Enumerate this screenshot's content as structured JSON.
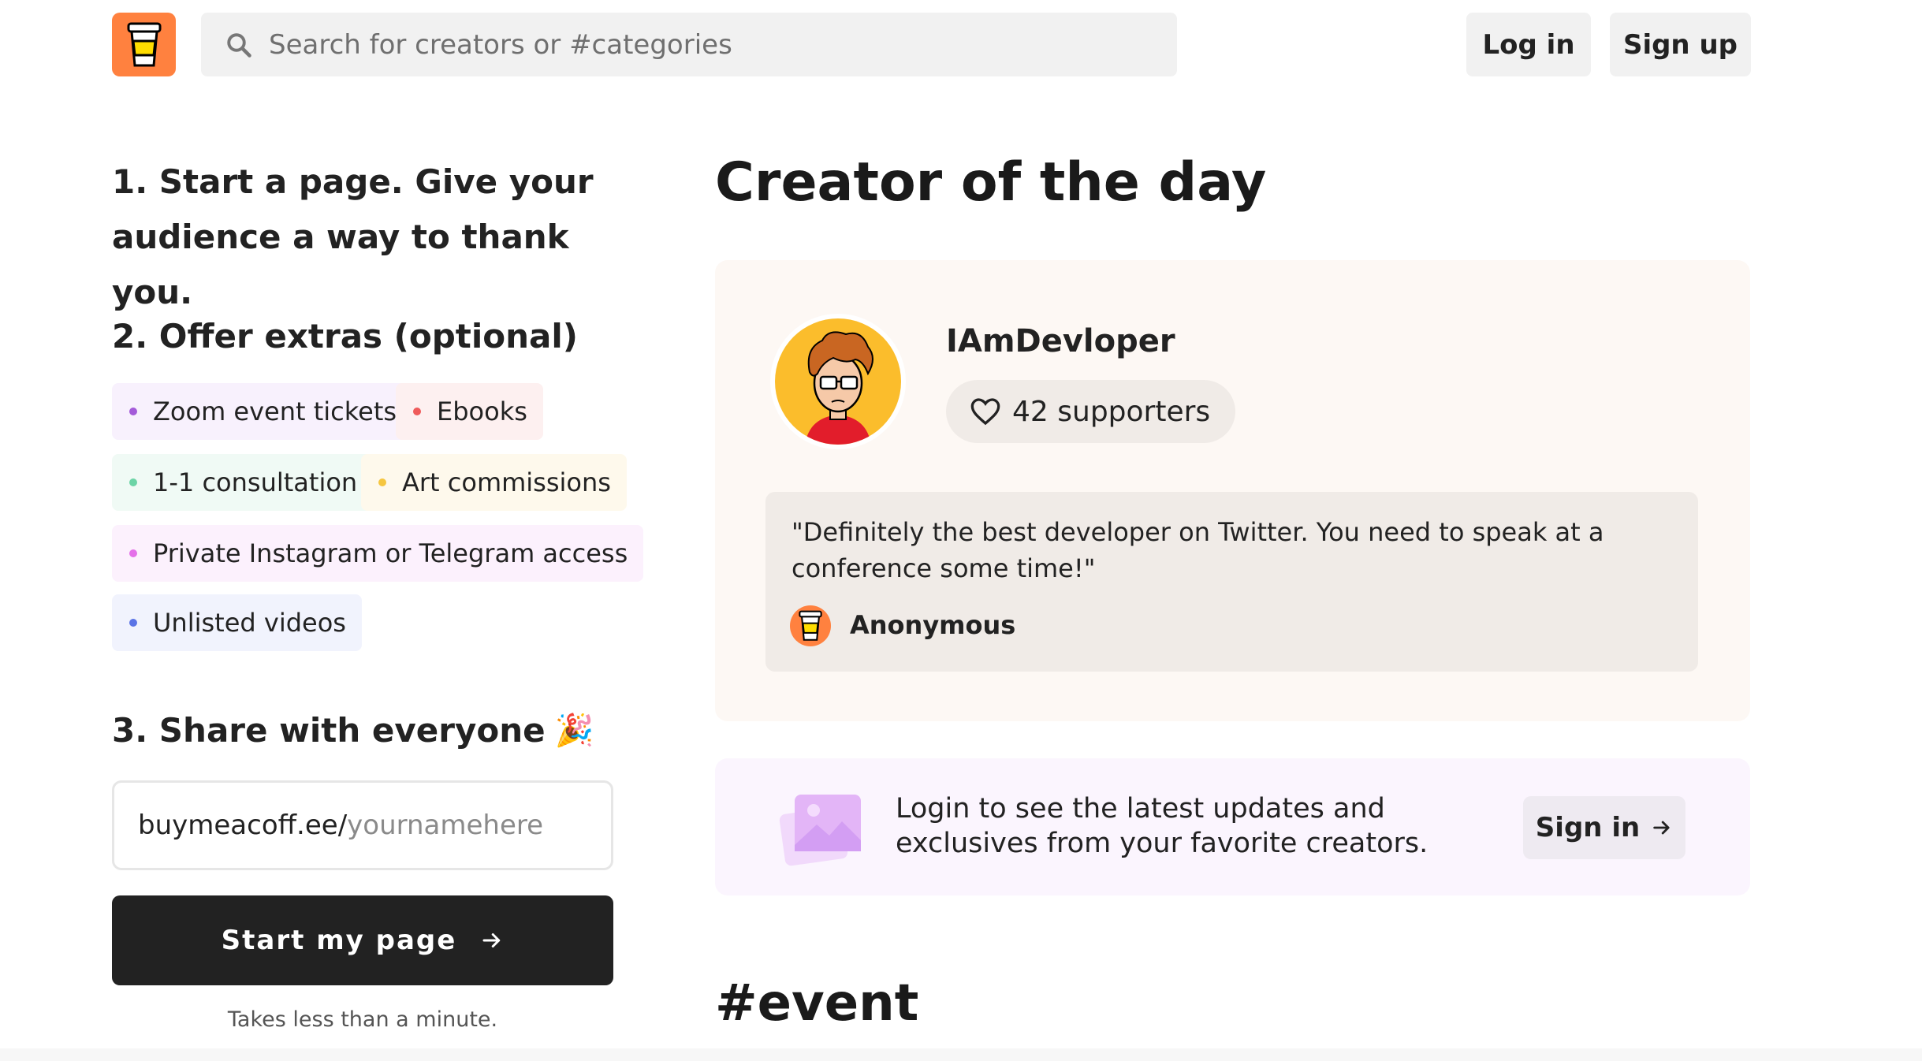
{
  "header": {
    "logo_icon": "coffee-cup-icon",
    "search_placeholder": "Search for creators or #categories",
    "login_label": "Log in",
    "signup_label": "Sign up"
  },
  "steps": {
    "step1": "1. Start a page. Give your audience a way to thank you.",
    "step2": "2. Offer extras (optional)",
    "step3": "3. Share with everyone",
    "step3_emoji": "🎉"
  },
  "extras": [
    {
      "label": "Zoom event tickets",
      "dot": "#a45bd9",
      "bg": "#f8f1fd"
    },
    {
      "label": "Ebooks",
      "dot": "#ef5b5b",
      "bg": "#fdf0f0"
    },
    {
      "label": "1-1 consultation",
      "dot": "#6cd4a6",
      "bg": "#f0faf5"
    },
    {
      "label": "Art commissions",
      "dot": "#f5c640",
      "bg": "#fef9ec"
    },
    {
      "label": "Private Instagram or Telegram access",
      "dot": "#e470e9",
      "bg": "#fcf1fd"
    },
    {
      "label": "Unlisted videos",
      "dot": "#5b74e6",
      "bg": "#f1f3fd"
    }
  ],
  "share": {
    "url_prefix": "buymeacoff.ee/",
    "url_placeholder": "yournamehere",
    "start_button": "Start my page",
    "note": "Takes less than a minute."
  },
  "creator_of_day": {
    "title": "Creator of the day",
    "name": "IAmDevloper",
    "supporters": "42 supporters",
    "quote": "\"Definitely the best developer on Twitter. You need to speak at a conference some time!\"",
    "quote_author": "Anonymous"
  },
  "login_prompt": {
    "text": "Login to see the latest updates and exclusives from your favorite creators.",
    "button": "Sign in"
  },
  "event_heading": "#event",
  "colors": {
    "brand_orange": "#ff813f",
    "dark_button": "#222222"
  }
}
